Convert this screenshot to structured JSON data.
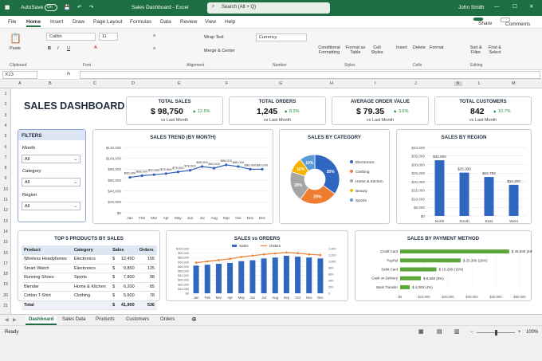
{
  "app": {
    "autosave": "AutoSave",
    "autosave_state": "On",
    "title": "Sales Dashboard - Excel",
    "search_placeholder": "Search (Alt + Q)",
    "user": "John Smith"
  },
  "menu": [
    "File",
    "Home",
    "Insert",
    "Draw",
    "Page Layout",
    "Formulas",
    "Data",
    "Review",
    "View",
    "Help"
  ],
  "share_label": "Share",
  "comments_label": "Comments",
  "ribbon": {
    "paste": "Paste",
    "clipboard": "Clipboard",
    "font_name": "Calibri",
    "font_size": "11",
    "font": "Font",
    "wrap": "Wrap Text",
    "merge": "Merge & Center",
    "alignment": "Alignment",
    "num_format": "Currency",
    "number": "Number",
    "cond": "Conditional Formatting",
    "fmt_table": "Format as Table",
    "cell_styles": "Cell Styles",
    "styles": "Styles",
    "insert": "Insert",
    "delete": "Delete",
    "format": "Format",
    "cells": "Cells",
    "sort": "Sort & Filter",
    "find": "Find & Select",
    "editing": "Editing"
  },
  "formula_bar": {
    "cell_ref": "K13",
    "fx": "fx"
  },
  "columns": [
    "A",
    "B",
    "C",
    "D",
    "E",
    "F",
    "G",
    "H",
    "I",
    "J",
    "K",
    "L",
    "M"
  ],
  "rows": [
    "1",
    "2",
    "3",
    "4",
    "5",
    "6",
    "7",
    "8",
    "9",
    "10",
    "11",
    "12",
    "13",
    "14",
    "15",
    "16",
    "17",
    "18",
    "19",
    "20",
    "21"
  ],
  "dashboard_title": "SALES DASHBOARD",
  "kpis": [
    {
      "title": "TOTAL SALES",
      "value": "$ 98,750",
      "delta": "▲ 12.5%",
      "sub": "vs Last Month"
    },
    {
      "title": "TOTAL ORDERS",
      "value": "1,245",
      "delta": "▲ 8.3%",
      "sub": "vs Last Month"
    },
    {
      "title": "AVERAGE ORDER VALUE",
      "value": "$ 79.35",
      "delta": "▲ 3.6%",
      "sub": "vs Last Month"
    },
    {
      "title": "TOTAL CUSTOMERS",
      "value": "842",
      "delta": "▲ 10.7%",
      "sub": "vs Last Month"
    }
  ],
  "filters": {
    "title": "FILTERS",
    "items": [
      {
        "label": "Month",
        "value": "All"
      },
      {
        "label": "Category",
        "value": "All"
      },
      {
        "label": "Region",
        "value": "All"
      }
    ]
  },
  "top_products": {
    "title": "TOP 5 PRODUCTS BY SALES",
    "headers": [
      "Product",
      "Category",
      "Sales",
      "Orders"
    ],
    "rows": [
      [
        "Wireless Headphones",
        "Electronics",
        "$",
        "12,450",
        "155"
      ],
      [
        "Smart Watch",
        "Electronics",
        "$",
        "9,850",
        "125"
      ],
      [
        "Running Shoes",
        "Sports",
        "$",
        "7,800",
        "98"
      ],
      [
        "Blender",
        "Home & Kitchen",
        "$",
        "6,200",
        "85"
      ],
      [
        "Cotton T-Shirt",
        "Clothing",
        "$",
        "5,600",
        "78"
      ]
    ],
    "total": [
      "Total",
      "",
      "$",
      "41,900",
      "536"
    ]
  },
  "sheet_tabs": [
    "Dashboard",
    "Sales Data",
    "Products",
    "Customers",
    "Orders"
  ],
  "status": {
    "ready": "Ready",
    "zoom": "100%"
  },
  "chart_data": [
    {
      "type": "line",
      "title": "SALES TREND (BY MONTH)",
      "categories": [
        "Jan",
        "Feb",
        "Mar",
        "Apr",
        "May",
        "Jun",
        "Jul",
        "Aug",
        "Sep",
        "Oct",
        "Nov",
        "Dec"
      ],
      "values": [
        65000,
        68000,
        70000,
        72000,
        75000,
        78000,
        85000,
        82000,
        88000,
        85000,
        80000,
        80000
      ],
      "labels": [
        "$65,000",
        "$68,000",
        "$70,000",
        "$72,000",
        "$75,000",
        "$78,000",
        "$85,000",
        "$82,000",
        "$88,000",
        "$85,000",
        "$80,000",
        "$80,000"
      ],
      "yticks": [
        "$0",
        "$20,000",
        "$40,000",
        "$60,000",
        "$80,000",
        "$100,000",
        "$120,000"
      ],
      "ylim": [
        0,
        120000
      ],
      "color": "#2f5fb5"
    },
    {
      "type": "pie",
      "title": "SALES BY CATEGORY",
      "slices": [
        {
          "name": "Electronics",
          "value": 35,
          "color": "#2f66c0"
        },
        {
          "name": "Clothing",
          "value": 25,
          "color": "#ed7d31"
        },
        {
          "name": "Home & Kitchen",
          "value": 20,
          "color": "#a5a5a5"
        },
        {
          "name": "Beauty",
          "value": 10,
          "color": "#f4b400"
        },
        {
          "name": "Sports",
          "value": 10,
          "color": "#5b9bd5"
        }
      ]
    },
    {
      "type": "bar",
      "title": "SALES BY REGION",
      "categories": [
        "North",
        "South",
        "East",
        "West"
      ],
      "values": [
        32500,
        25300,
        22750,
        18200
      ],
      "labels": [
        "$32,500",
        "$25,300",
        "$22,750",
        "$18,200"
      ],
      "yticks": [
        "$0",
        "$5,000",
        "$10,000",
        "$15,000",
        "$20,000",
        "$25,000",
        "$30,000",
        "$35,000",
        "$40,000"
      ],
      "ylim": [
        0,
        40000
      ],
      "color": "#2f66c0"
    },
    {
      "type": "bar",
      "title": "SALES vs ORDERS",
      "categories": [
        "Jan",
        "Feb",
        "Mar",
        "Apr",
        "May",
        "Jun",
        "Jul",
        "Aug",
        "Sep",
        "Oct",
        "Nov",
        "Dec"
      ],
      "series": [
        {
          "name": "Sales",
          "type": "bar",
          "values": [
            62000,
            64000,
            66000,
            68000,
            72000,
            74000,
            78000,
            80000,
            84000,
            82000,
            80000,
            78000
          ],
          "color": "#2f66c0"
        },
        {
          "name": "Orders",
          "type": "line",
          "values": [
            960,
            1000,
            1040,
            1080,
            1140,
            1180,
            1220,
            1250,
            1280,
            1260,
            1220,
            1200
          ],
          "color": "#ed7d31"
        }
      ],
      "yticks": [
        "$0",
        "$10,000",
        "$20,000",
        "$30,000",
        "$40,000",
        "$50,000",
        "$60,000",
        "$70,000",
        "$80,000",
        "$90,000",
        "$100,000"
      ],
      "ylim": [
        0,
        100000
      ],
      "y2ticks": [
        "0",
        "200",
        "400",
        "600",
        "800",
        "1,000",
        "1,200",
        "1,400"
      ],
      "y2lim": [
        0,
        1400
      ]
    },
    {
      "type": "bar",
      "orientation": "horizontal",
      "title": "SALES BY PAYMENT METHOD",
      "categories": [
        "Credit Card",
        "PayPal",
        "Debit Card",
        "Cash on Delivery",
        "Bank Transfer"
      ],
      "values": [
        45600,
        25300,
        15200,
        8650,
        4000
      ],
      "labels": [
        "$ 45,600 (46%)",
        "$ 25,300 (26%)",
        "$ 15,200 (15%)",
        "$ 8,650 (9%)",
        "$ 4,000 (4%)"
      ],
      "xticks": [
        "$0",
        "$10,000",
        "$20,000",
        "$30,000",
        "$40,000",
        "$50,000"
      ],
      "xlim": [
        0,
        50000
      ],
      "color": "#5aa63a"
    }
  ]
}
